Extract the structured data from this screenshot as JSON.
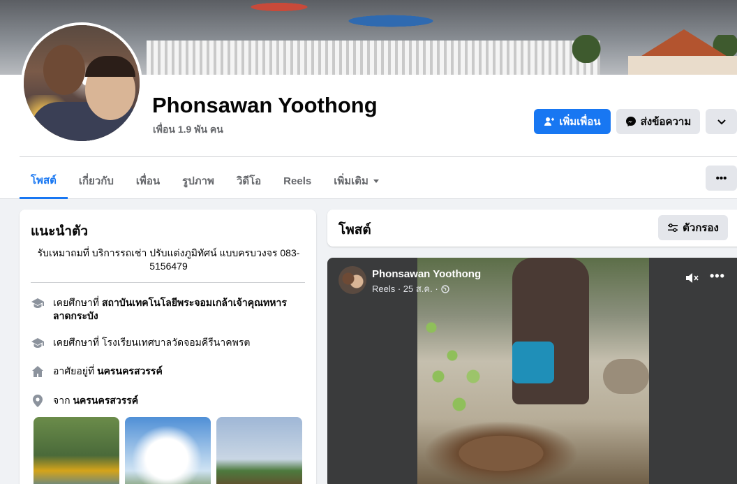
{
  "profile": {
    "name": "Phonsawan Yoothong",
    "friends_count": "เพื่อน 1.9 พัน คน"
  },
  "actions": {
    "add_friend": "เพิ่มเพื่อน",
    "message": "ส่งข้อความ"
  },
  "tabs": [
    {
      "label": "โพสต์"
    },
    {
      "label": "เกี่ยวกับ"
    },
    {
      "label": "เพื่อน"
    },
    {
      "label": "รูปภาพ"
    },
    {
      "label": "วิดีโอ"
    },
    {
      "label": "Reels"
    },
    {
      "label": "เพิ่มเติม"
    }
  ],
  "intro": {
    "title": "แนะนำตัว",
    "bio": "รับเหมาถมที่ บริการรถเช่า ปรับแต่งภูมิทัศน์ แบบครบวงจร 083-5156479",
    "items": [
      {
        "icon": "graduation-cap-icon",
        "prefix": "เคยศึกษาที่ ",
        "value": "สถาบันเทคโนโลยีพระจอมเกล้าเจ้าคุณทหารลาดกระบัง"
      },
      {
        "icon": "graduation-cap-icon",
        "prefix": "เคยศึกษาที่ ",
        "value": "โรงเรียนเทศบาลวัดจอมคีรีนาคพรต"
      },
      {
        "icon": "home-icon",
        "prefix": "อาศัยอยู่ที่ ",
        "value": "นครนครสวรรค์"
      },
      {
        "icon": "location-pin-icon",
        "prefix": "จาก ",
        "value": "นครนครสวรรค์"
      }
    ]
  },
  "posts": {
    "title": "โพสต์",
    "filter_label": "ตัวกรอง"
  },
  "reel_post": {
    "author": "Phonsawan Yoothong",
    "meta": "Reels · 25 ส.ค. ·"
  },
  "colors": {
    "accent": "#1877f2",
    "page_bg": "#f0f2f5",
    "secondary_button": "#e4e6eb",
    "muted_text": "#65676b"
  }
}
